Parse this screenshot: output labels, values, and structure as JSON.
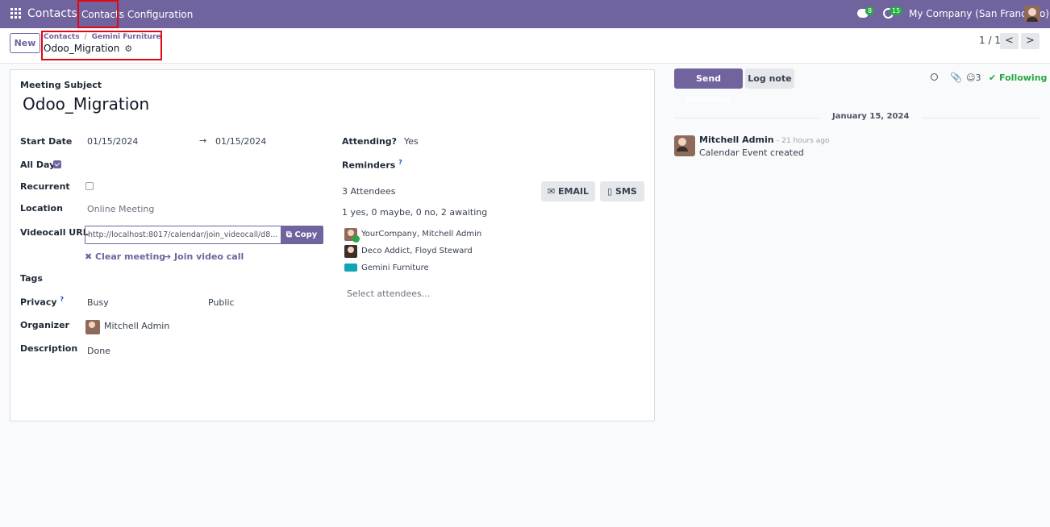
{
  "navbar": {
    "brand": "Contacts",
    "menu": [
      "Contacts",
      "Configuration"
    ],
    "messages_count": "8",
    "activities_count": "15",
    "company": "My Company (San Francisco)"
  },
  "control_panel": {
    "new_label": "New",
    "breadcrumb": [
      "Contacts",
      "Gemini Furniture"
    ],
    "breadcrumb_sep": "/",
    "current": "Odoo_Migration",
    "pager": "1 / 1",
    "prev": "<",
    "next": ">"
  },
  "form": {
    "subject_label": "Meeting Subject",
    "subject": "Odoo_Migration",
    "start_date_label": "Start Date",
    "start_date": "01/15/2024",
    "arrow": "→",
    "end_date": "01/15/2024",
    "all_day_label": "All Day",
    "all_day": true,
    "recurrent_label": "Recurrent",
    "recurrent": false,
    "location_label": "Location",
    "location": "Online Meeting",
    "videocall_label": "Videocall URL",
    "videocall_url": "http://localhost:8017/calendar/join_videocall/d8...",
    "copy_label": "Copy",
    "clear_meeting": "✖ Clear meeting",
    "join_video": "➔ Join video call",
    "tags_label": "Tags",
    "privacy_label": "Privacy",
    "privacy_help": "?",
    "show_as": "Busy",
    "privacy": "Public",
    "organizer_label": "Organizer",
    "organizer": "Mitchell Admin",
    "description_label": "Description",
    "description": "Done",
    "attending_label": "Attending?",
    "attending": "Yes",
    "reminders_label": "Reminders",
    "reminders_help": "?",
    "attendees_count": "3 Attendees",
    "email_label": "EMAIL",
    "sms_label": "SMS",
    "attendee_summary": "1 yes, 0 maybe, 0 no, 2 awaiting",
    "attendees": [
      "YourCompany, Mitchell Admin",
      "Deco Addict, Floyd Steward",
      "Gemini Furniture"
    ],
    "select_attendees": "Select attendees..."
  },
  "chatter": {
    "send_message": "Send message",
    "log_note": "Log note",
    "followers_count": "3",
    "following": "Following",
    "date_separator": "January 15, 2024",
    "message": {
      "author": "Mitchell Admin",
      "time": "- 21 hours ago",
      "body": "Calendar Event created"
    }
  },
  "colors": {
    "brand": "#71639e",
    "success": "#28a745",
    "highlight": "#e30613"
  }
}
